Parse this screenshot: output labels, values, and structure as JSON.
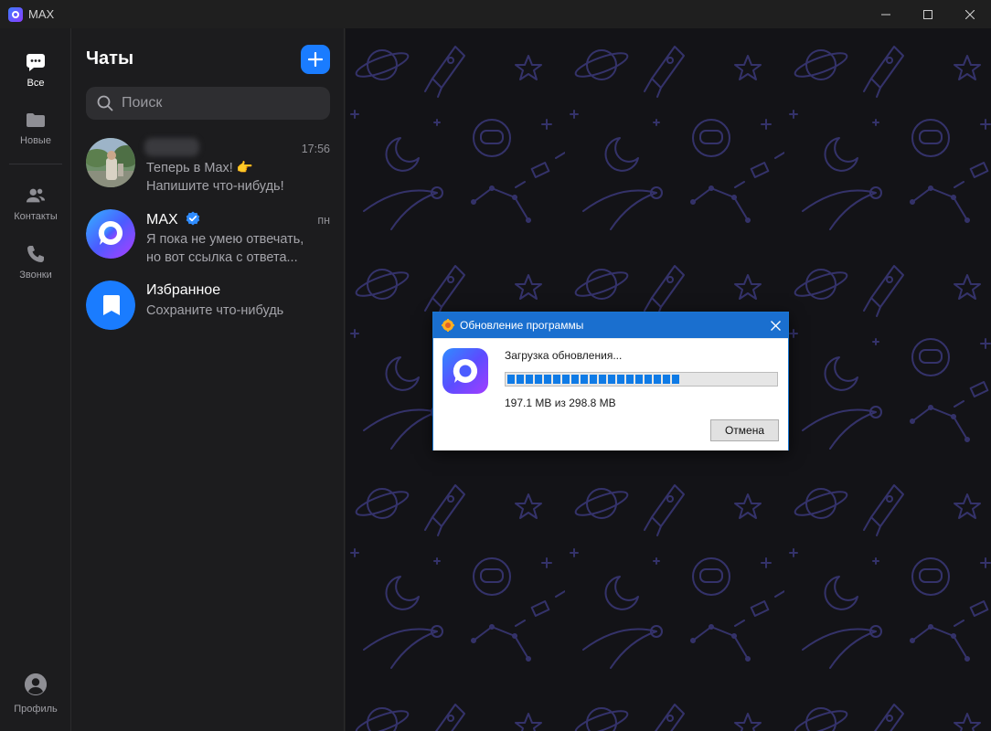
{
  "window": {
    "title": "MAX",
    "controls": {
      "minimize": "—",
      "maximize": "☐",
      "close": "✕"
    }
  },
  "rail": {
    "items": [
      {
        "label": "Все",
        "icon": "chat-bubble-icon",
        "active": true
      },
      {
        "label": "Новые",
        "icon": "folder-icon",
        "active": false
      },
      {
        "label": "Контакты",
        "icon": "contacts-icon",
        "active": false
      },
      {
        "label": "Звонки",
        "icon": "phone-icon",
        "active": false
      }
    ],
    "profile_label": "Профиль"
  },
  "chats": {
    "title": "Чаты",
    "search_placeholder": "Поиск",
    "items": [
      {
        "name": "",
        "time": "17:56",
        "preview_line1": "Теперь в Max! 👉",
        "preview_line2": "Напишите что-нибудь!"
      },
      {
        "name": "MAX",
        "verified": true,
        "time": "пн",
        "preview_line1": "Я пока не умею отвечать,",
        "preview_line2": "но вот ссылка с ответа..."
      },
      {
        "name": "Избранное",
        "time": "",
        "preview_line1": "Сохраните что-нибудь",
        "preview_line2": ""
      }
    ]
  },
  "update_dialog": {
    "title": "Обновление программы",
    "close": "✕",
    "status": "Загрузка обновления...",
    "progress": 0.66,
    "size_text": "197.1 MB из 298.8 MB",
    "cancel_label": "Отмена"
  },
  "colors": {
    "accent": "#1a7cff",
    "dialog_titlebar": "#1a6fcf",
    "progress_fill": "#0f7be6",
    "wallpaper_bg": "#131317",
    "wallpaper_doodle": "#3a3870"
  }
}
